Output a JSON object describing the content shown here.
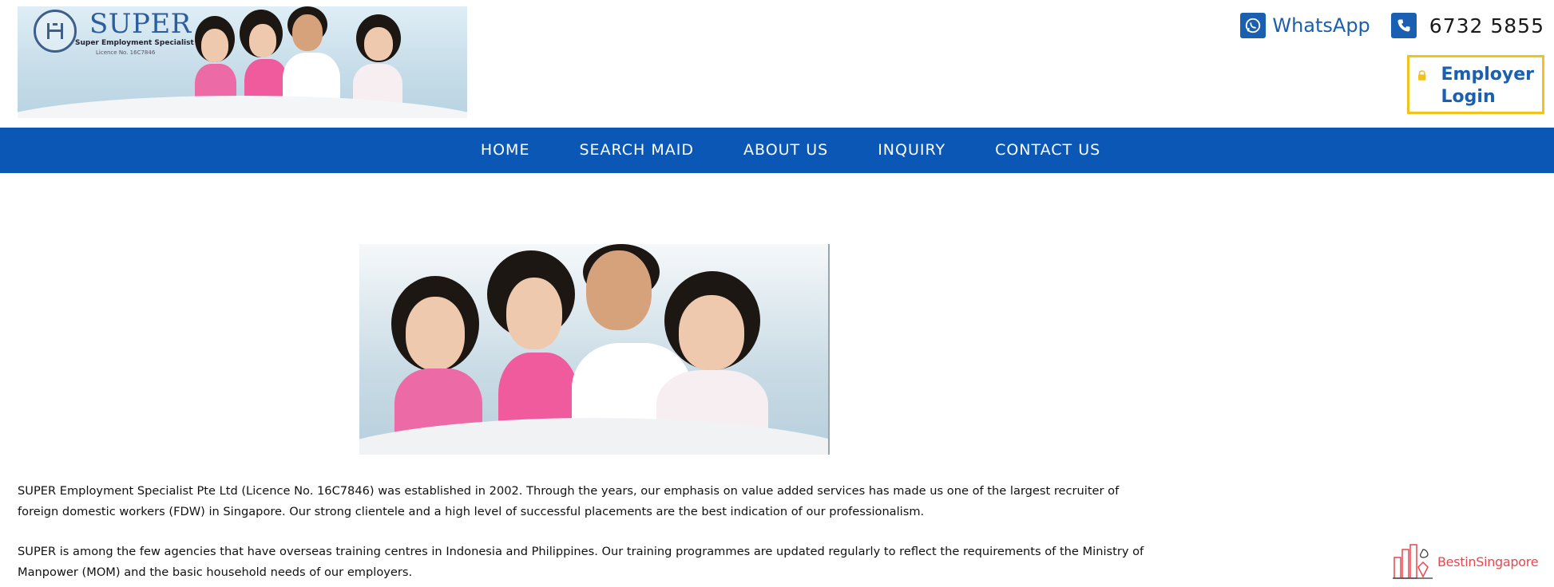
{
  "logo": {
    "name": "SUPER",
    "full_name": "Super Employment Specialist Pte Ltd",
    "licence": "Licence No. 16C7846"
  },
  "contact": {
    "whatsapp_label": "WhatsApp",
    "phone_number": "6732 5855",
    "employer_login_label": "Employer Login"
  },
  "nav": {
    "items": [
      {
        "label": "HOME"
      },
      {
        "label": "SEARCH MAID"
      },
      {
        "label": "ABOUT US"
      },
      {
        "label": "INQUIRY"
      },
      {
        "label": "CONTACT US"
      }
    ]
  },
  "content": {
    "paragraphs": [
      "SUPER Employment Specialist Pte Ltd (Licence No. 16C7846) was established in 2002. Through the years, our emphasis on value added services has made us one of the largest recruiter of foreign domestic workers (FDW) in Singapore. Our strong clientele and a high level of successful placements are the best indication of our professionalism.",
      "SUPER is among the few agencies that have overseas training centres in Indonesia and Philippines. Our training programmes are updated regularly to reflect the requirements of the Ministry of Manpower (MOM) and the basic household needs of our employers."
    ]
  },
  "badge": {
    "text": "BestinSingapore"
  },
  "colors": {
    "nav_bg": "#0b57b5",
    "accent_blue": "#1b5fb0",
    "login_border": "#f2c21c",
    "badge_red": "#e8474f"
  }
}
